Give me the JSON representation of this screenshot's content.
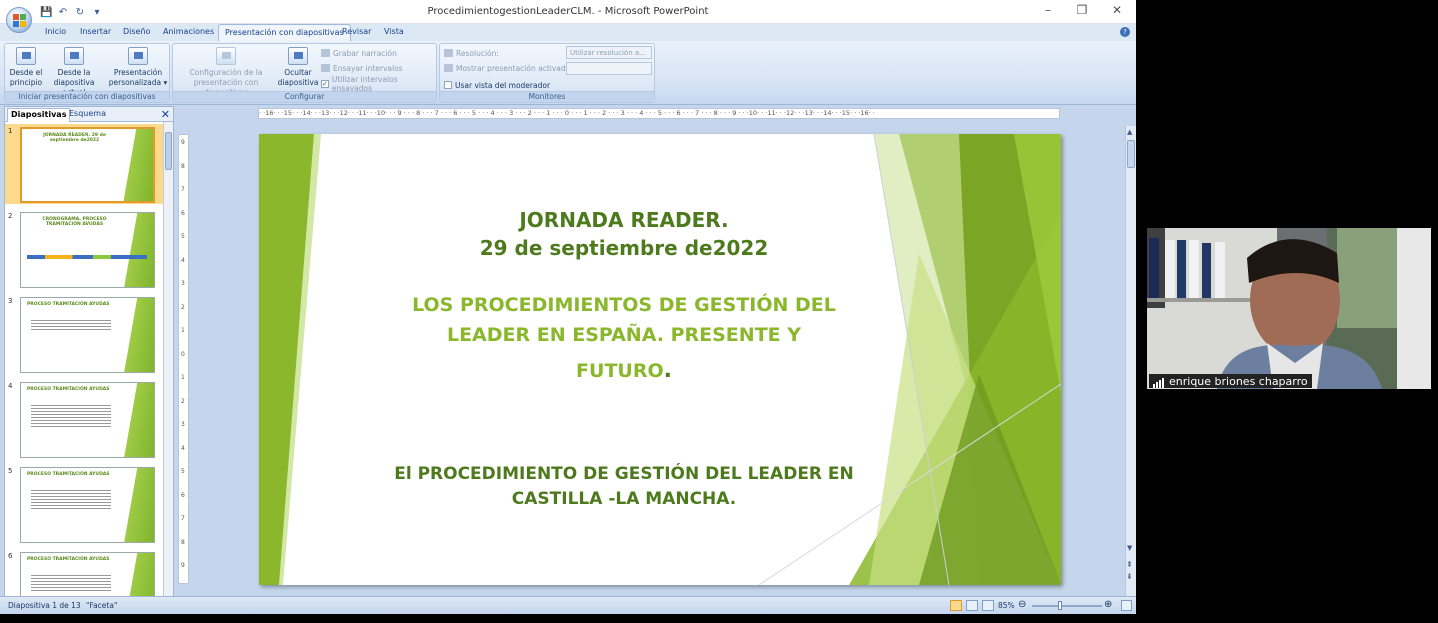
{
  "window": {
    "title": "ProcedimientogestionLeaderCLM. - Microsoft PowerPoint"
  },
  "tabs": [
    "Inicio",
    "Insertar",
    "Diseño",
    "Animaciones",
    "Presentación con diapositivas",
    "Revisar",
    "Vista"
  ],
  "active_tab": "Presentación con diapositivas",
  "ribbon": {
    "group1": {
      "label": "Iniciar presentación con diapositivas",
      "btn1": "Desde el principio",
      "btn1a": "Desde el",
      "btn1b": "principio",
      "btn2a": "Desde la",
      "btn2b": "diapositiva actual",
      "btn3a": "Presentación",
      "btn3b": "personalizada"
    },
    "group2": {
      "label": "Configurar",
      "btn1a": "Configuración de la",
      "btn1b": "presentación con diapositivas",
      "btn2a": "Ocultar",
      "btn2b": "diapositiva",
      "grabar": "Grabar narración",
      "ensayar": "Ensayar intervalos",
      "utilizar": "Utilizar intervalos ensayados"
    },
    "group3": {
      "label": "Monitores",
      "resolucion": "Resolución:",
      "resolucion_value": "Utilizar resolución a...",
      "mostrar": "Mostrar presentación activada:",
      "vista_moderador": "Usar vista del moderador"
    }
  },
  "panel": {
    "tab1": "Diapositivas",
    "tab2": "Esquema",
    "thumbs": [
      {
        "num": "1",
        "title": "JORNADA READER. 29 de septiembre de2022"
      },
      {
        "num": "2",
        "title": "CRONOGRAMA. PROCESO TRAMITACIÓN AVUDAS"
      },
      {
        "num": "3",
        "title": "PROCESO TRAMITACIÓN AYUDAS"
      },
      {
        "num": "4",
        "title": "PROCESO TRAMITACIÓN AYUDAS"
      },
      {
        "num": "5",
        "title": "PROCESO TRAMITACIÓN AYUDAS"
      },
      {
        "num": "6",
        "title": "PROCESO TRAMITACIÓN AYUDAS"
      }
    ]
  },
  "ruler": {
    "horizontal": "· ·16· · ·15· · ·14· · ·13· · ·12· · ·11· · ·10· · · 9 · · · 8 · · · 7 · · · 6 · · · 5 · · · 4 · · · 3 · · · 2 · · · 1 · · · 0 · · · 1 · · · 2 · · · 3 · · · 4 · · · 5 · · · 6 · · · 7 · · · 8 · · · 9 · · ·10· · ·11· · ·12· · ·13· · ·14· · ·15· · ·16· ·",
    "vertical": [
      "9",
      "8",
      "7",
      "6",
      "5",
      "4",
      "3",
      "2",
      "1",
      "0",
      "1",
      "2",
      "3",
      "4",
      "5",
      "6",
      "7",
      "8",
      "9"
    ]
  },
  "slide": {
    "line1": "JORNADA READER.",
    "line2": "29 de septiembre de2022",
    "line3": "LOS PROCEDIMIENTOS DE GESTIÓN DEL",
    "line4": "LEADER EN ESPAÑA. PRESENTE Y",
    "line5": "FUTURO",
    "line5_dot": ".",
    "line6": "El PROCEDIMIENTO DE GESTIÓN DEL LEADER EN",
    "line7": "CASTILLA -LA MANCHA.",
    "colors": {
      "dark_green": "#4e7a1e",
      "light_green": "#8ab72b"
    }
  },
  "status": {
    "slide_info": "Diapositiva 1 de 13",
    "theme": "\"Faceta\"",
    "zoom": "85%"
  },
  "video": {
    "name": "enrique briones chaparro"
  }
}
